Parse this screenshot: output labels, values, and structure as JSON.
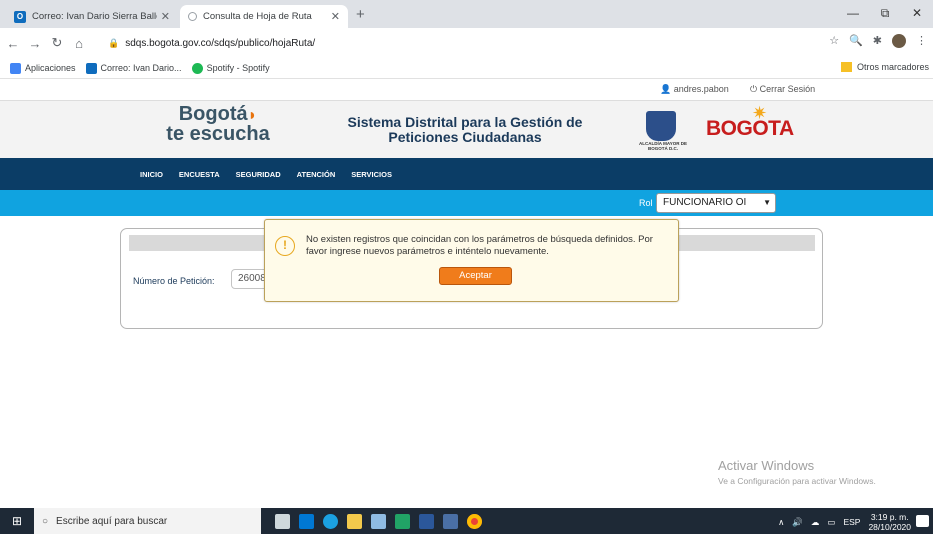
{
  "browser": {
    "tabs": [
      {
        "label": "Correo: Ivan Dario Sierra Balleste",
        "active": false,
        "favicon_color": "#0f6cbd"
      },
      {
        "label": "Consulta de Hoja de Ruta",
        "active": true,
        "favicon_color": "#9aa0a6"
      }
    ],
    "new_tab": "+",
    "window_controls": [
      "—",
      "⧉",
      "✕"
    ],
    "url": "sdqs.bogota.gov.co/sdqs/publico/hojaRuta/",
    "bookmarks": [
      {
        "label": "Aplicaciones",
        "color": "#4285f4"
      },
      {
        "label": "Correo: Ivan Dario...",
        "color": "#0f6cbd"
      },
      {
        "label": "Spotify - Spotify",
        "color": "#1db954"
      }
    ],
    "other_bookmarks": "Otros marcadores"
  },
  "page": {
    "user": "andres.pabon",
    "logout": "Cerrar Sesión",
    "logo_line1": "Bogotá",
    "logo_line2": "te escucha",
    "system_title_line1": "Sistema Distrital para la Gestión de",
    "system_title_line2": "Peticiones Ciudadanas",
    "escudo_label": "ALCALDÍA MAYOR DE BOGOTÁ D.C.",
    "logo_right": "BOGOTA",
    "nav": [
      "INICIO",
      "ENCUESTA",
      "SEGURIDAD",
      "ATENCIÓN",
      "SERVICIOS"
    ],
    "rol_label": "Rol",
    "rol_value": "FUNCIONARIO OI",
    "peticion_label": "Número de Petición:",
    "peticion_value": "26008"
  },
  "dialog": {
    "message": "No existen registros que coincidan con los parámetros de búsqueda definidos. Por favor ingrese nuevos parámetros e inténtelo nuevamente.",
    "accept": "Aceptar"
  },
  "watermark": {
    "title": "Activar Windows",
    "subtitle": "Ve a Configuración para activar Windows."
  },
  "taskbar": {
    "search_placeholder": "Escribe aquí para buscar",
    "language": "ESP",
    "time": "3:19 p. m.",
    "date": "28/10/2020",
    "app_colors": [
      "#cfd8dc",
      "#0078d4",
      "#1ba1e2",
      "#f2c94c",
      "#8fbbe3",
      "#21a366",
      "#2b579a",
      "#4a6fa5",
      "#ea4335"
    ]
  }
}
